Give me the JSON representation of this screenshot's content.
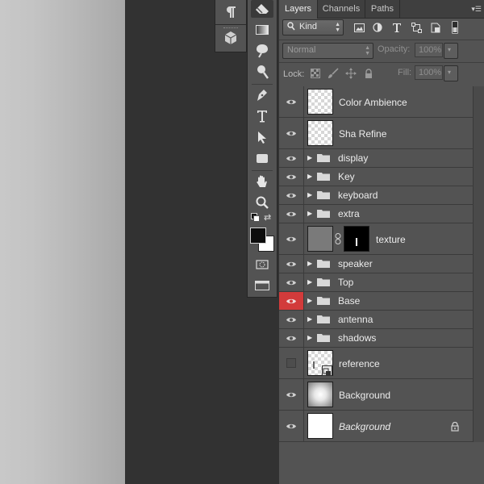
{
  "tabs": [
    {
      "label": "Layers",
      "active": true
    },
    {
      "label": "Channels",
      "active": false
    },
    {
      "label": "Paths",
      "active": false
    }
  ],
  "filter": {
    "kind_label": "Kind",
    "icons": [
      "image-filter-icon",
      "adjustment-filter-icon",
      "type-filter-icon",
      "shape-filter-icon",
      "smart-object-filter-icon",
      "filter-toggle-icon"
    ]
  },
  "blend": {
    "mode": "Normal",
    "opacity_label": "Opacity:",
    "opacity_value": "100%"
  },
  "lock": {
    "label": "Lock:",
    "fill_label": "Fill:",
    "fill_value": "100%"
  },
  "layers": [
    {
      "name": "Color Ambience",
      "type": "raster",
      "visible": true
    },
    {
      "name": "Sha Refine",
      "type": "raster",
      "visible": true
    },
    {
      "name": "display",
      "type": "group",
      "visible": true
    },
    {
      "name": "Key",
      "type": "group",
      "visible": true
    },
    {
      "name": "keyboard",
      "type": "group",
      "visible": true
    },
    {
      "name": "extra",
      "type": "group",
      "visible": true
    },
    {
      "name": "texture",
      "type": "masked",
      "visible": true
    },
    {
      "name": "speaker",
      "type": "group",
      "visible": true
    },
    {
      "name": "Top",
      "type": "group",
      "visible": true
    },
    {
      "name": "Base",
      "type": "group",
      "visible": true,
      "label_color": "#d23b3b"
    },
    {
      "name": "antenna",
      "type": "group",
      "visible": true
    },
    {
      "name": "shadows",
      "type": "group",
      "visible": true
    },
    {
      "name": "reference",
      "type": "smart",
      "visible": false
    },
    {
      "name": "Background",
      "type": "gradient",
      "visible": true
    },
    {
      "name": "Background",
      "type": "background",
      "visible": true,
      "locked": true
    }
  ],
  "colors": {
    "panel_bg": "#535353",
    "base_label": "#d23b3b"
  }
}
